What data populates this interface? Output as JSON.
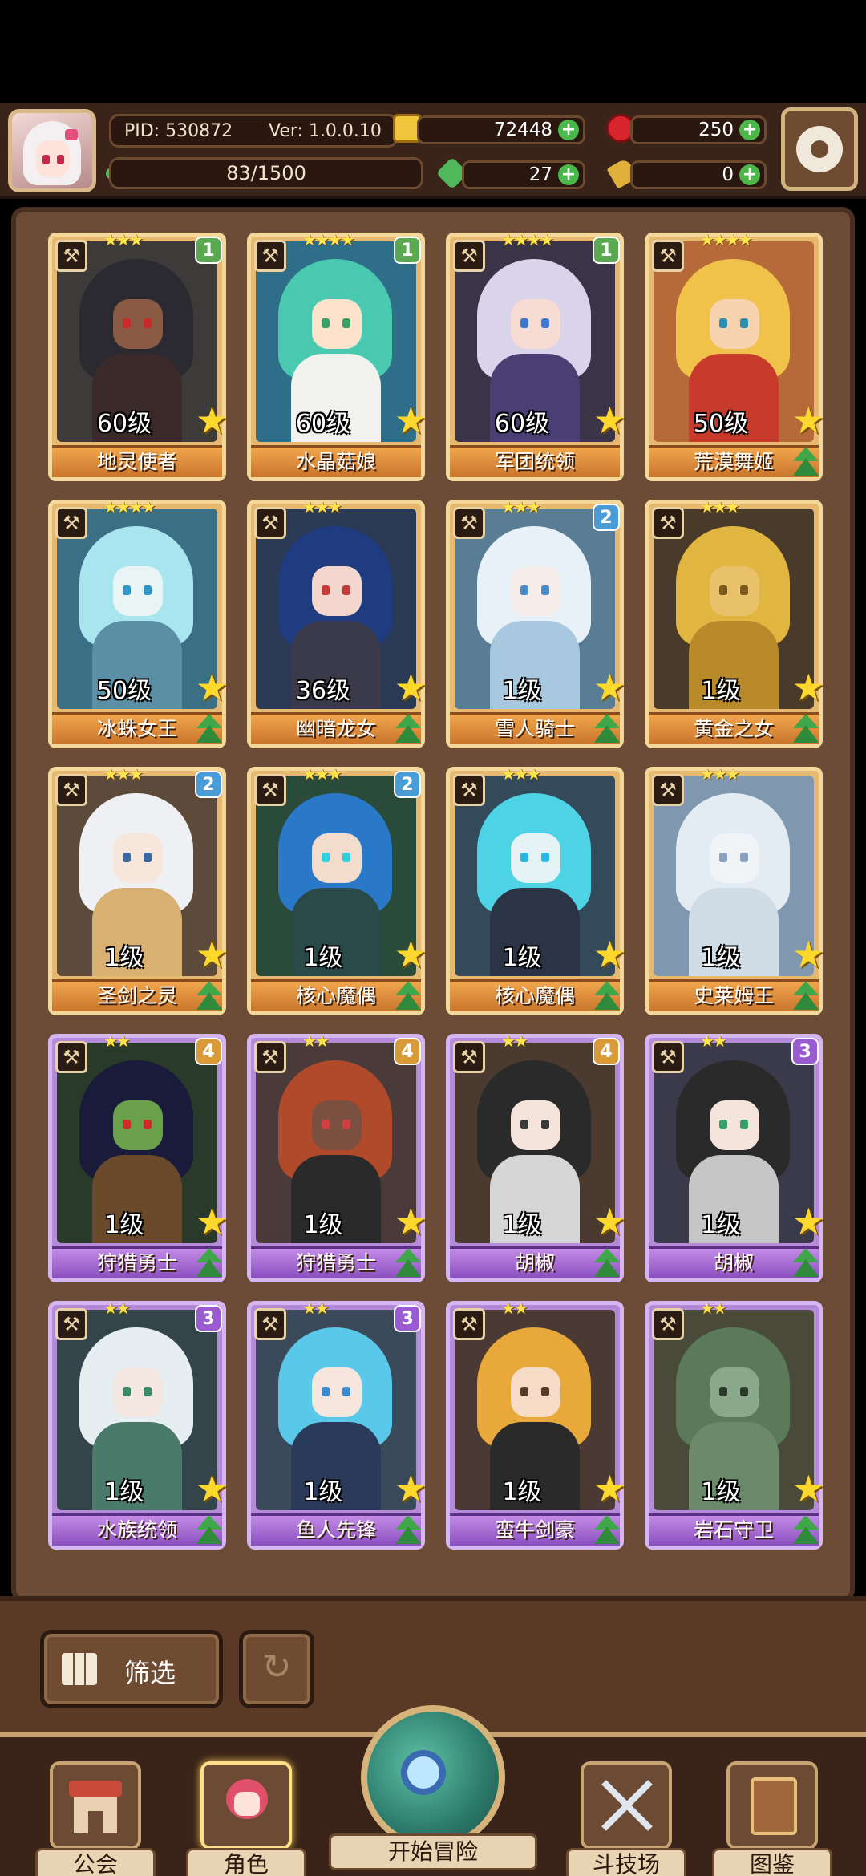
{
  "header": {
    "pid": "PID: 530872",
    "version": "Ver: 1.0.0.10",
    "exp": "83/1500",
    "gold": "72448",
    "gems": "250",
    "clover": "27",
    "key": "0"
  },
  "cards": [
    {
      "name": "地灵使者",
      "level": "60级",
      "stars": "★★★",
      "badge": "1",
      "tier": "gold",
      "badge_color": "#5aa84f",
      "hair": "#2a2a30",
      "skin": "#8a5a44",
      "outfit": "#3a2a2a",
      "eye": "#c92b2b",
      "bg": "#3d3a3a"
    },
    {
      "name": "水晶菇娘",
      "level": "60级",
      "stars": "★★★★",
      "badge": "1",
      "tier": "gold",
      "badge_color": "#5aa84f",
      "hair": "#49c9b0",
      "skin": "#fde2cc",
      "outfit": "#f1f1ee",
      "eye": "#3aa06a",
      "bg": "#2f6e89"
    },
    {
      "name": "军团统领",
      "level": "60级",
      "stars": "★★★★",
      "badge": "1",
      "tier": "gold",
      "badge_color": "#5aa84f",
      "hair": "#d9d4ea",
      "skin": "#f7dcd4",
      "outfit": "#4a3f72",
      "eye": "#3c7ad2",
      "bg": "#3b3348"
    },
    {
      "name": "荒漠舞姬",
      "level": "50级",
      "stars": "★★★★",
      "badge": "",
      "tier": "gold",
      "badge_color": "",
      "hair": "#f1c24a",
      "skin": "#f7d2ae",
      "outfit": "#c73a2c",
      "eye": "#2a8fb0",
      "bg": "#b66a3a"
    },
    {
      "name": "冰蛛女王",
      "level": "50级",
      "stars": "★★★★",
      "badge": "",
      "tier": "gold",
      "badge_color": "",
      "hair": "#a8e5ee",
      "skin": "#e9f4f5",
      "outfit": "#5a8fa5",
      "eye": "#2c97c7",
      "bg": "#3a6f86"
    },
    {
      "name": "幽暗龙女",
      "level": "36级",
      "stars": "★★★",
      "badge": "",
      "tier": "gold",
      "badge_color": "",
      "hair": "#1f3c80",
      "skin": "#f3d6cd",
      "outfit": "#3a3a4a",
      "eye": "#c23a3a",
      "bg": "#2a3a55"
    },
    {
      "name": "雪人骑士",
      "level": "1级",
      "stars": "★★★",
      "badge": "2",
      "tier": "gold",
      "badge_color": "#4a9cd6",
      "hair": "#e8f1f7",
      "skin": "#f6ecea",
      "outfit": "#a8c8e0",
      "eye": "#4d8bc4",
      "bg": "#5a7d96"
    },
    {
      "name": "黄金之女",
      "level": "1级",
      "stars": "★★★",
      "badge": "",
      "tier": "gold",
      "badge_color": "",
      "hair": "#e0b640",
      "skin": "#e8c16a",
      "outfit": "#b88a2a",
      "eye": "#7a5a1a",
      "bg": "#4a3a2a"
    },
    {
      "name": "圣剑之灵",
      "level": "1级",
      "stars": "★★★",
      "badge": "2",
      "tier": "gold",
      "badge_color": "#4a9cd6",
      "hair": "#eef0f3",
      "skin": "#f7e6dc",
      "outfit": "#d7b072",
      "eye": "#3a6aa0",
      "bg": "#5c4a3a"
    },
    {
      "name": "核心魔偶",
      "level": "1级",
      "stars": "★★★",
      "badge": "2",
      "tier": "gold",
      "badge_color": "#4a9cd6",
      "hair": "#2a78c8",
      "skin": "#f4dccd",
      "outfit": "#2a4a4a",
      "eye": "#2ed0e0",
      "bg": "#2a4a3a"
    },
    {
      "name": "核心魔偶",
      "level": "1级",
      "stars": "★★★",
      "badge": "",
      "tier": "gold",
      "badge_color": "",
      "hair": "#4ed2e6",
      "skin": "#e6f3f6",
      "outfit": "#2a3444",
      "eye": "#2ab6e0",
      "bg": "#334a5a"
    },
    {
      "name": "史莱姆王",
      "level": "1级",
      "stars": "★★★",
      "badge": "",
      "tier": "gold",
      "badge_color": "",
      "hair": "#e4ecf3",
      "skin": "#f0f4f7",
      "outfit": "#d0dce6",
      "eye": "#8aa0c0",
      "bg": "#7f98b0"
    },
    {
      "name": "狩猎勇士",
      "level": "1级",
      "stars": "★★",
      "badge": "4",
      "tier": "purple",
      "badge_color": "#d99a3a",
      "hair": "#1a1a3a",
      "skin": "#6aa04a",
      "outfit": "#6a4a2a",
      "eye": "#d02a2a",
      "bg": "#2a3a2a"
    },
    {
      "name": "狩猎勇士",
      "level": "1级",
      "stars": "★★",
      "badge": "4",
      "tier": "purple",
      "badge_color": "#d99a3a",
      "hair": "#b04a2a",
      "skin": "#7a5040",
      "outfit": "#2a2a2a",
      "eye": "#d04040",
      "bg": "#4a3a3a"
    },
    {
      "name": "胡椒",
      "level": "1级",
      "stars": "★★",
      "badge": "4",
      "tier": "purple",
      "badge_color": "#d99a3a",
      "hair": "#2a2a2a",
      "skin": "#f4e4dc",
      "outfit": "#d6d6d6",
      "eye": "#3a3a3a",
      "bg": "#4a3a30"
    },
    {
      "name": "胡椒",
      "level": "1级",
      "stars": "★★",
      "badge": "3",
      "tier": "purple",
      "badge_color": "#9a5ad0",
      "hair": "#2a2a2a",
      "skin": "#f4e4dc",
      "outfit": "#c6c6c6",
      "eye": "#3aa06a",
      "bg": "#3a3a4a"
    },
    {
      "name": "水族统领",
      "level": "1级",
      "stars": "★★",
      "badge": "3",
      "tier": "purple",
      "badge_color": "#9a5ad0",
      "hair": "#e6eef2",
      "skin": "#f4e6e0",
      "outfit": "#4a7a6a",
      "eye": "#3a8a6a",
      "bg": "#33444a"
    },
    {
      "name": "鱼人先锋",
      "level": "1级",
      "stars": "★★",
      "badge": "3",
      "tier": "purple",
      "badge_color": "#9a5ad0",
      "hair": "#5ac8e8",
      "skin": "#f6e6de",
      "outfit": "#2a3a5a",
      "eye": "#3a8ad0",
      "bg": "#3a4a5a"
    },
    {
      "name": "蛮牛剑豪",
      "level": "1级",
      "stars": "★★",
      "badge": "",
      "tier": "purple",
      "badge_color": "",
      "hair": "#e8a83a",
      "skin": "#f6dcc6",
      "outfit": "#2a2a2a",
      "eye": "#5a3a2a",
      "bg": "#4a3a33"
    },
    {
      "name": "岩石守卫",
      "level": "1级",
      "stars": "★★",
      "badge": "",
      "tier": "purple",
      "badge_color": "",
      "hair": "#5a7a5a",
      "skin": "#8aa88a",
      "outfit": "#6a8a6a",
      "eye": "#2a3a2a",
      "bg": "#4a4a3a"
    }
  ],
  "filter": {
    "label": "筛选"
  },
  "nav": {
    "guild": "公会",
    "character": "角色",
    "adventure": "开始冒险",
    "arena": "斗技场",
    "codex": "图鉴"
  },
  "colors": {
    "gold_card": "#e7b870",
    "purple_card": "#b48ad9",
    "accent_green": "#4cb84a"
  },
  "icons": {
    "class_icon": "wrench-icon",
    "gear": "gear-icon",
    "filter": "grid-icon",
    "reset": "refresh-icon"
  }
}
